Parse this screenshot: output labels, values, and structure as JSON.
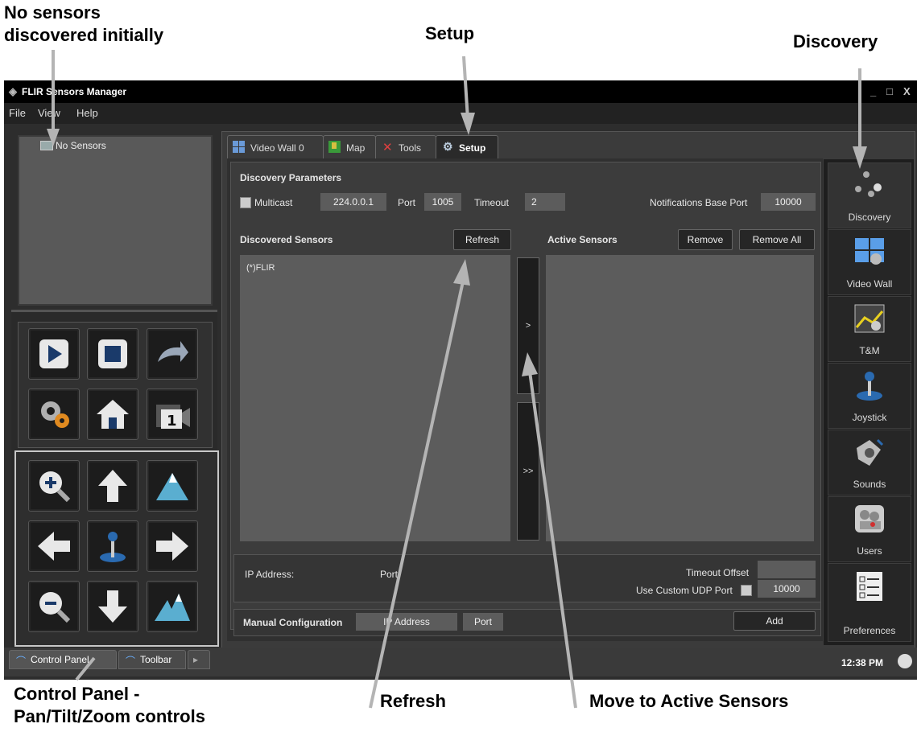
{
  "callouts": {
    "top_left": "No sensors\ndiscovered initially",
    "setup": "Setup",
    "discovery": "Discovery",
    "control_panel": "Control Panel -\nPan/Tilt/Zoom controls",
    "refresh": "Refresh",
    "move": "Move to Active Sensors"
  },
  "window": {
    "title": "FLIR Sensors Manager",
    "controls": {
      "minimize": "_",
      "maximize": "□",
      "close": "X"
    }
  },
  "menu": [
    "File",
    "View",
    "Help"
  ],
  "tree": {
    "item": "No Sensors"
  },
  "tabs": [
    "Video Wall 0",
    "Map",
    "Tools",
    "Setup"
  ],
  "discovery_params": {
    "heading": "Discovery Parameters",
    "multicast_label": "Multicast",
    "multicast_address": "224.0.0.1",
    "port_label": "Port",
    "port": "1005",
    "timeout_label": "Timeout",
    "timeout": "2",
    "notif_label": "Notifications Base Port",
    "notif_port": "10000"
  },
  "discovered": {
    "heading": "Discovered Sensors",
    "refresh": "Refresh",
    "items": [
      "(*)FLIR"
    ]
  },
  "active": {
    "heading": "Active Sensors",
    "remove": "Remove",
    "remove_all": "Remove All"
  },
  "move_buttons": {
    "single": ">",
    "all": ">>"
  },
  "details": {
    "ip_label": "IP Address:",
    "port_label": "Port",
    "timeout_offset_label": "Timeout Offset",
    "udp_label": "Use Custom UDP Port",
    "udp_port": "10000"
  },
  "manual": {
    "heading": "Manual Configuration",
    "ip_placeholder": "IP Address",
    "port_placeholder": "Port",
    "add": "Add"
  },
  "sidebar": [
    "Discovery",
    "Video Wall",
    "T&M",
    "Joystick",
    "Sounds",
    "Users",
    "Preferences"
  ],
  "bottom_tabs": [
    "Control Panel",
    "Toolbar"
  ],
  "status": {
    "time": "12:38 PM"
  },
  "colors": {
    "accent_blue": "#3a7bd5",
    "panel": "#3b3b3b",
    "field": "#5c5c5c"
  }
}
